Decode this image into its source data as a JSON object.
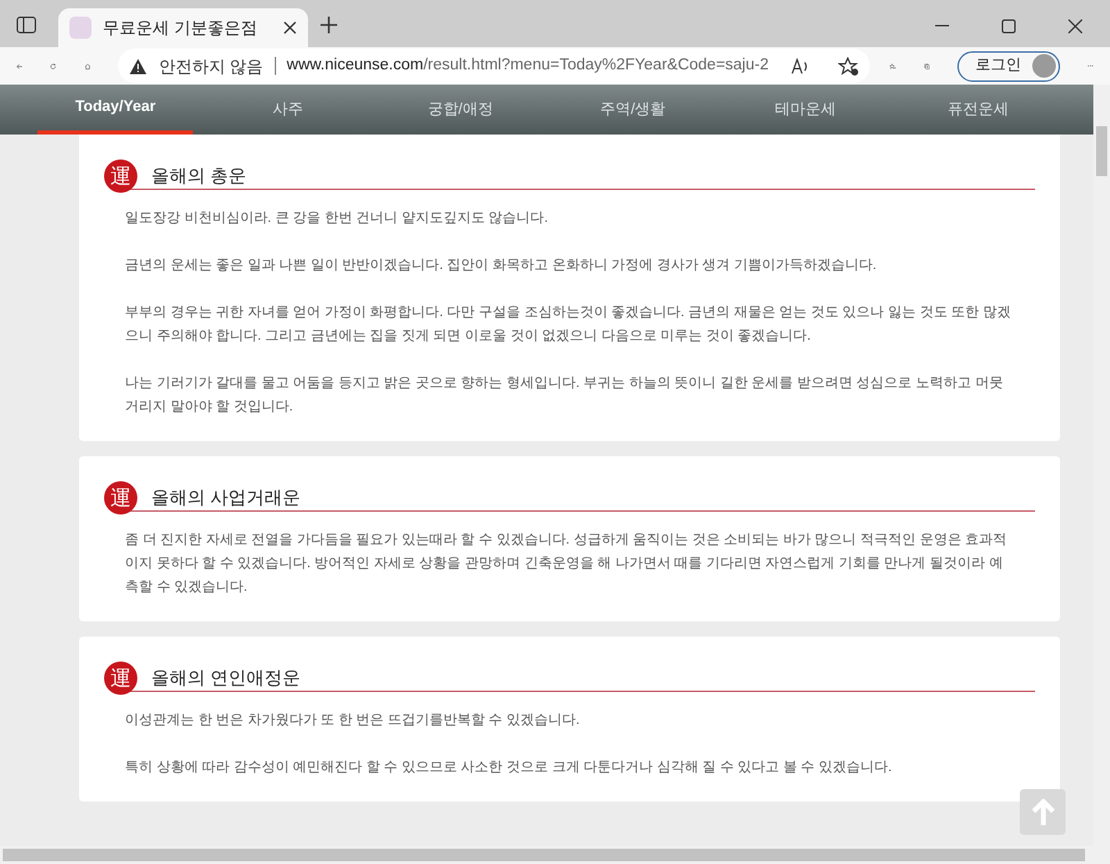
{
  "browser": {
    "tab_title": "무료운세 기분좋은점",
    "address_warning": "안전하지 않음",
    "url_host": "www.niceunse.com",
    "url_path": "/result.html?menu=Today%2FYear&Code=saju-2",
    "login": "로그인"
  },
  "nav": [
    {
      "label": "Today/Year",
      "selected": true
    },
    {
      "label": "사주",
      "selected": false
    },
    {
      "label": "궁합/애정",
      "selected": false
    },
    {
      "label": "주역/생활",
      "selected": false
    },
    {
      "label": "테마운세",
      "selected": false
    },
    {
      "label": "퓨전운세",
      "selected": false
    }
  ],
  "sections": [
    {
      "emblem": "運",
      "title": "올해의 총운",
      "paragraphs": [
        "일도장강 비천비심이라. 큰 강을 한번 건너니 얕지도깊지도 않습니다.",
        "금년의 운세는 좋은 일과 나쁜 일이 반반이겠습니다. 집안이 화목하고 온화하니 가정에 경사가 생겨 기쁨이가득하겠습니다.",
        "부부의 경우는 귀한 자녀를 얻어 가정이 화평합니다. 다만 구설을 조심하는것이 좋겠습니다. 금년의 재물은 얻는 것도 있으나 잃는 것도 또한 많겠으니 주의해야 합니다. 그리고 금년에는 집을 짓게 되면 이로울 것이 없겠으니 다음으로 미루는 것이 좋겠습니다.",
        "나는 기러기가 갈대를 물고 어둠을 등지고 밝은 곳으로 향하는 형세입니다. 부귀는 하늘의 뜻이니 길한 운세를 받으려면 성심으로 노력하고 머뭇거리지 말아야 할 것입니다."
      ]
    },
    {
      "emblem": "運",
      "title": "올해의 사업거래운",
      "paragraphs": [
        "좀 더 진지한 자세로 전열을 가다듬을 필요가 있는때라 할 수 있겠습니다. 성급하게 움직이는 것은 소비되는 바가 많으니 적극적인 운영은 효과적이지 못하다 할 수 있겠습니다. 방어적인 자세로 상황을 관망하며 긴축운영을 해 나가면서 때를 기다리면 자연스럽게 기회를 만나게 될것이라 예측할 수 있겠습니다."
      ]
    },
    {
      "emblem": "運",
      "title": "올해의 연인애정운",
      "paragraphs": [
        "이성관계는 한 번은 차가웠다가 또 한 번은 뜨겁기를반복할 수 있겠습니다.",
        "특히 상황에 따라 감수성이 예민해진다 할 수 있으므로 사소한 것으로 크게 다툰다거나 심각해 질 수 있다고 볼 수 있겠습니다."
      ]
    }
  ]
}
